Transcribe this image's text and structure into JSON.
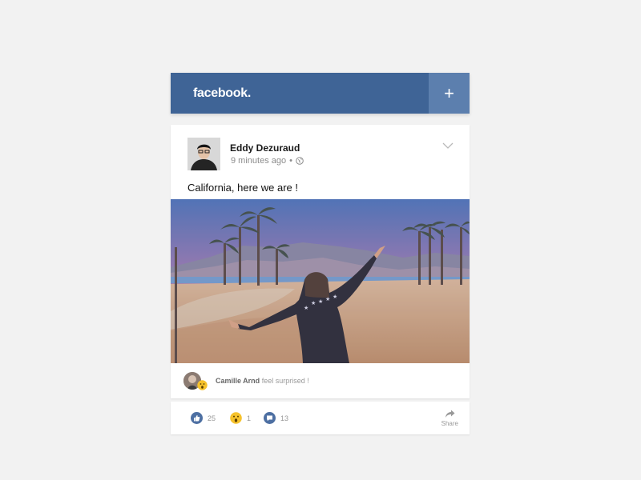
{
  "app": {
    "brand": "facebook.",
    "new_post_icon": "plus-icon"
  },
  "post": {
    "author": "Eddy Dezuraud",
    "timestamp": "9 minutes ago",
    "separator": "•",
    "privacy_icon": "globe-icon",
    "text": "California, here we are !",
    "menu_icon": "chevron-down-icon"
  },
  "reaction_preview": {
    "user": "Camille Arnd",
    "text": " feel surprised !",
    "emoji_icon": "wow-emoji-icon"
  },
  "actions": {
    "likes": "25",
    "wows": "1",
    "comments": "13",
    "share_label": "Share"
  },
  "colors": {
    "brand_blue": "#3f6496",
    "plus_blue": "#5c7fae",
    "action_blue": "#4d6fa2"
  }
}
